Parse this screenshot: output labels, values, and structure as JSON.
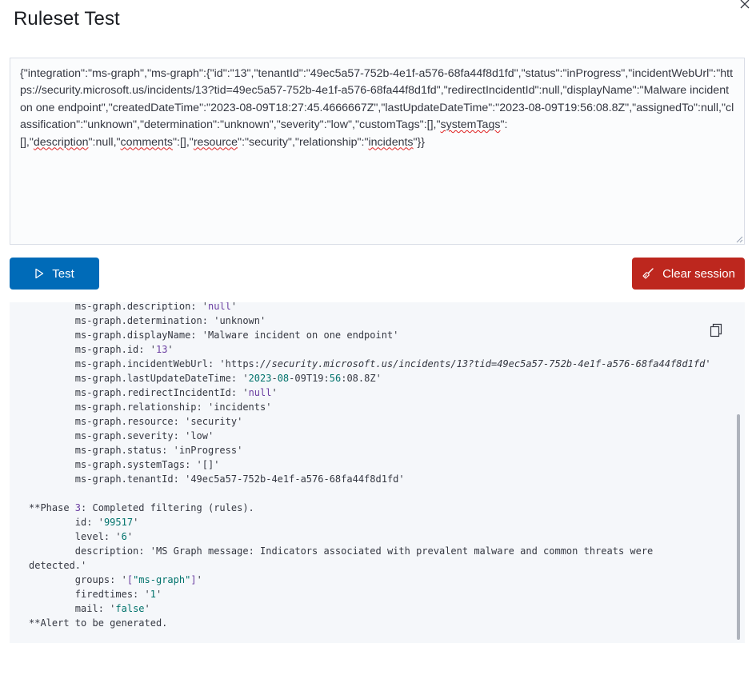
{
  "modal": {
    "title": "Ruleset Test",
    "close_icon": "close-icon"
  },
  "log_input": {
    "seg1": "{\"integration\":\"ms-graph\",\"ms-graph\":{\"id\":\"13\",\"tenantId\":\"49ec5a57-752b-4e1f-a576-68fa44f8d1fd\",\"status\":\"inProgress\",\"incidentWebUrl\":\"https://security.microsoft.us/incidents/13?tid=49ec5a57-752b-4e1f-a576-68fa44f8d1fd\",\"redirectIncidentId\":null,\"displayName\":\"Malware incident on one endpoint\",\"createdDateTime\":\"2023-08-09T18:27:45.4666667Z\",\"lastUpdateDateTime\":\"2023-08-09T19:56:08.8Z\",\"assignedTo\":null,\"classification\":\"unknown\",\"determination\":\"unknown\",\"severity\":\"low\",\"customTags\":[],\"",
    "seg2": "systemTags",
    "seg3": "\":\n[],\"",
    "seg4": "description",
    "seg5": "\":null,\"",
    "seg6": "comments",
    "seg7": "\":[],\"",
    "seg8": "resource",
    "seg9": "\":\"security\",\"relationship\":\"",
    "seg10": "incidents",
    "seg11": "\"}}"
  },
  "buttons": {
    "test_label": "Test",
    "test_icon": "play-icon",
    "clear_label": "Clear session",
    "clear_icon": "broom-icon",
    "copy_icon": "copy-icon"
  },
  "output": {
    "fields": [
      {
        "key": "ms-graph.description",
        "value": "null",
        "type": "number"
      },
      {
        "key": "ms-graph.determination",
        "value": "unknown",
        "type": "plain"
      },
      {
        "key": "ms-graph.displayName",
        "value": "Malware incident on one endpoint",
        "type": "plain"
      },
      {
        "key": "ms-graph.id",
        "value": "13",
        "type": "number"
      },
      {
        "key": "ms-graph.incidentWebUrl",
        "value": "https://security.microsoft.us/incidents/13?tid=49ec5a57-752b-4e1f-a576-68fa44f8d1fd",
        "type": "url"
      },
      {
        "key": "ms-graph.lastUpdateDateTime",
        "value": "2023-08-09T19:56:08.8Z",
        "type": "datetime"
      },
      {
        "key": "ms-graph.redirectIncidentId",
        "value": "null",
        "type": "number"
      },
      {
        "key": "ms-graph.relationship",
        "value": "incidents",
        "type": "plain"
      },
      {
        "key": "ms-graph.resource",
        "value": "security",
        "type": "plain"
      },
      {
        "key": "ms-graph.severity",
        "value": "low",
        "type": "plain"
      },
      {
        "key": "ms-graph.status",
        "value": "inProgress",
        "type": "plain"
      },
      {
        "key": "ms-graph.systemTags",
        "value": "[]",
        "type": "plain"
      },
      {
        "key": "ms-graph.tenantId",
        "value": "49ec5a57-752b-4e1f-a576-68fa44f8d1fd",
        "type": "plain"
      }
    ],
    "phase_prefix": "**Phase ",
    "phase_number": "3",
    "phase_suffix": ": Completed filtering (rules).",
    "rule_id_key": "id",
    "rule_id": "99517",
    "level_key": "level",
    "level": "6",
    "description_key": "description",
    "description": "MS Graph message: Indicators associated with prevalent malware and common threats were detected.",
    "groups_key": "groups",
    "groups": "[\"ms-graph\"]",
    "firedtimes_key": "firedtimes",
    "firedtimes": "1",
    "mail_key": "mail",
    "mail": "false",
    "alert": "**Alert to be generated."
  }
}
